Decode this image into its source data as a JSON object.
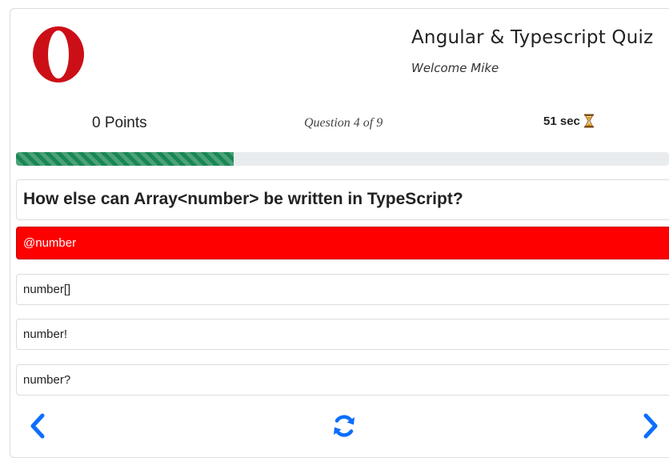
{
  "header": {
    "title": "Angular & Typescript Quiz",
    "welcome": "Welcome Mike",
    "logo_icon": "opera-logo-icon"
  },
  "status": {
    "points": "0 Points",
    "question_progress": "Question 4 of 9",
    "timer": "51 sec",
    "timer_icon": "hourglass-icon",
    "progress_fraction": 0.333
  },
  "question": {
    "text": "How else can Array<number> be written in TypeScript?"
  },
  "options": [
    {
      "label": "@number",
      "selected": true
    },
    {
      "label": "number[]",
      "selected": false
    },
    {
      "label": "number!",
      "selected": false
    },
    {
      "label": "number?",
      "selected": false
    }
  ],
  "nav": {
    "prev_icon": "chevron-left-icon",
    "refresh_icon": "refresh-icon",
    "next_icon": "chevron-right-icon"
  },
  "colors": {
    "selected_option": "#ff0000",
    "progress_fill": "#198754",
    "nav_icon": "#0d6efd",
    "logo": "#cc0f16"
  }
}
